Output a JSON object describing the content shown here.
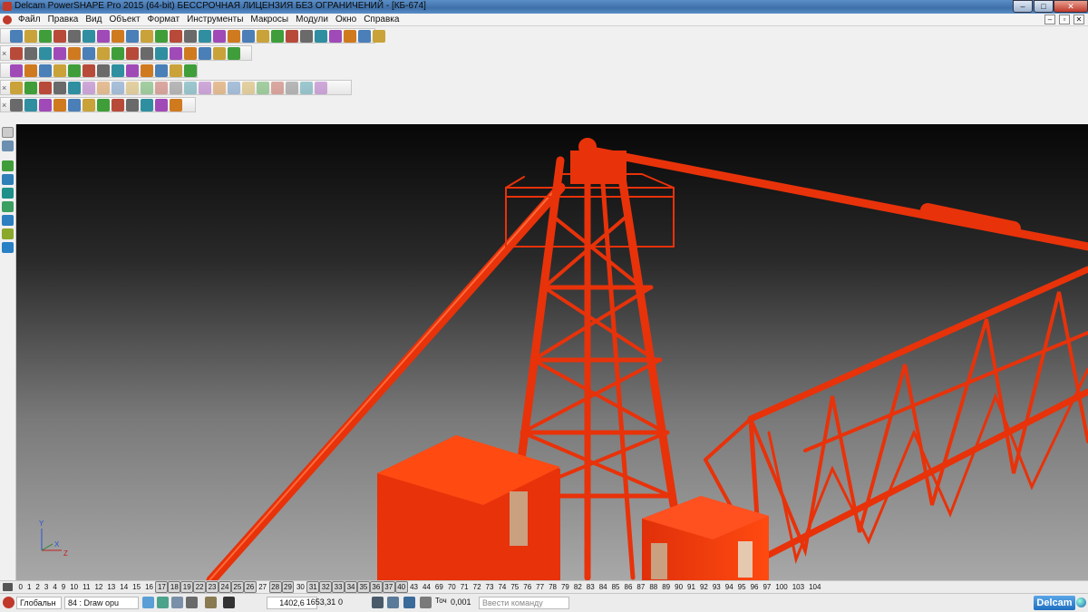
{
  "window": {
    "title": "Delcam PowerSHAPE Pro 2015 (64-bit) БЕССРОЧНАЯ ЛИЦЕНЗИЯ БЕЗ ОГРАНИЧЕНИЙ - [КБ-674]",
    "minimize_label": "–",
    "maximize_label": "□",
    "close_label": "✕"
  },
  "menu": {
    "items": [
      "Файл",
      "Правка",
      "Вид",
      "Объект",
      "Формат",
      "Инструменты",
      "Макросы",
      "Модули",
      "Окно",
      "Справка"
    ],
    "mdi_minimize": "–",
    "mdi_restore": "▫",
    "mdi_close": "✕"
  },
  "toolbars": {
    "close_glyph": "×"
  },
  "viewport": {
    "model_color": "#e8320a",
    "axis_labels": {
      "y": "Y",
      "x": "X",
      "z": "Z"
    }
  },
  "levels": {
    "items": [
      {
        "label": "0",
        "on": false
      },
      {
        "label": "1",
        "on": false
      },
      {
        "label": "2",
        "on": false
      },
      {
        "label": "3",
        "on": false
      },
      {
        "label": "4",
        "on": false
      },
      {
        "label": "9",
        "on": false
      },
      {
        "label": "10",
        "on": false
      },
      {
        "label": "11",
        "on": false
      },
      {
        "label": "12",
        "on": false
      },
      {
        "label": "13",
        "on": false
      },
      {
        "label": "14",
        "on": false
      },
      {
        "label": "15",
        "on": false
      },
      {
        "label": "16",
        "on": false
      },
      {
        "label": "17",
        "on": true
      },
      {
        "label": "18",
        "on": true
      },
      {
        "label": "19",
        "on": true
      },
      {
        "label": "22",
        "on": true
      },
      {
        "label": "23",
        "on": true
      },
      {
        "label": "24",
        "on": true
      },
      {
        "label": "25",
        "on": true
      },
      {
        "label": "26",
        "on": true
      },
      {
        "label": "27",
        "on": false
      },
      {
        "label": "28",
        "on": true
      },
      {
        "label": "29",
        "on": true
      },
      {
        "label": "30",
        "on": false
      },
      {
        "label": "31",
        "on": true
      },
      {
        "label": "32",
        "on": true
      },
      {
        "label": "33",
        "on": true
      },
      {
        "label": "34",
        "on": true
      },
      {
        "label": "35",
        "on": true
      },
      {
        "label": "36",
        "on": true
      },
      {
        "label": "37",
        "on": true
      },
      {
        "label": "40",
        "on": true
      },
      {
        "label": "43",
        "on": false
      },
      {
        "label": "44",
        "on": false
      },
      {
        "label": "69",
        "on": false
      },
      {
        "label": "70",
        "on": false
      },
      {
        "label": "71",
        "on": false
      },
      {
        "label": "72",
        "on": false
      },
      {
        "label": "73",
        "on": false
      },
      {
        "label": "74",
        "on": false
      },
      {
        "label": "75",
        "on": false
      },
      {
        "label": "76",
        "on": false
      },
      {
        "label": "77",
        "on": false
      },
      {
        "label": "78",
        "on": false
      },
      {
        "label": "79",
        "on": false
      },
      {
        "label": "82",
        "on": false
      },
      {
        "label": "83",
        "on": false
      },
      {
        "label": "84",
        "on": false
      },
      {
        "label": "85",
        "on": false
      },
      {
        "label": "86",
        "on": false
      },
      {
        "label": "87",
        "on": false
      },
      {
        "label": "88",
        "on": false
      },
      {
        "label": "89",
        "on": false
      },
      {
        "label": "90",
        "on": false
      },
      {
        "label": "91",
        "on": false
      },
      {
        "label": "92",
        "on": false
      },
      {
        "label": "93",
        "on": false
      },
      {
        "label": "94",
        "on": false
      },
      {
        "label": "95",
        "on": false
      },
      {
        "label": "96",
        "on": false
      },
      {
        "label": "97",
        "on": false
      },
      {
        "label": "100",
        "on": false
      },
      {
        "label": "103",
        "on": false
      },
      {
        "label": "104",
        "on": false
      }
    ]
  },
  "status": {
    "workplane": "Глобальн",
    "level": "84 : Draw opu",
    "x": "1402,6",
    "y": "1653,31",
    "z": "0",
    "tolerance_label": "Точ",
    "tolerance": "0,001",
    "command_placeholder": "Ввести команду",
    "brand": "Delcam"
  }
}
